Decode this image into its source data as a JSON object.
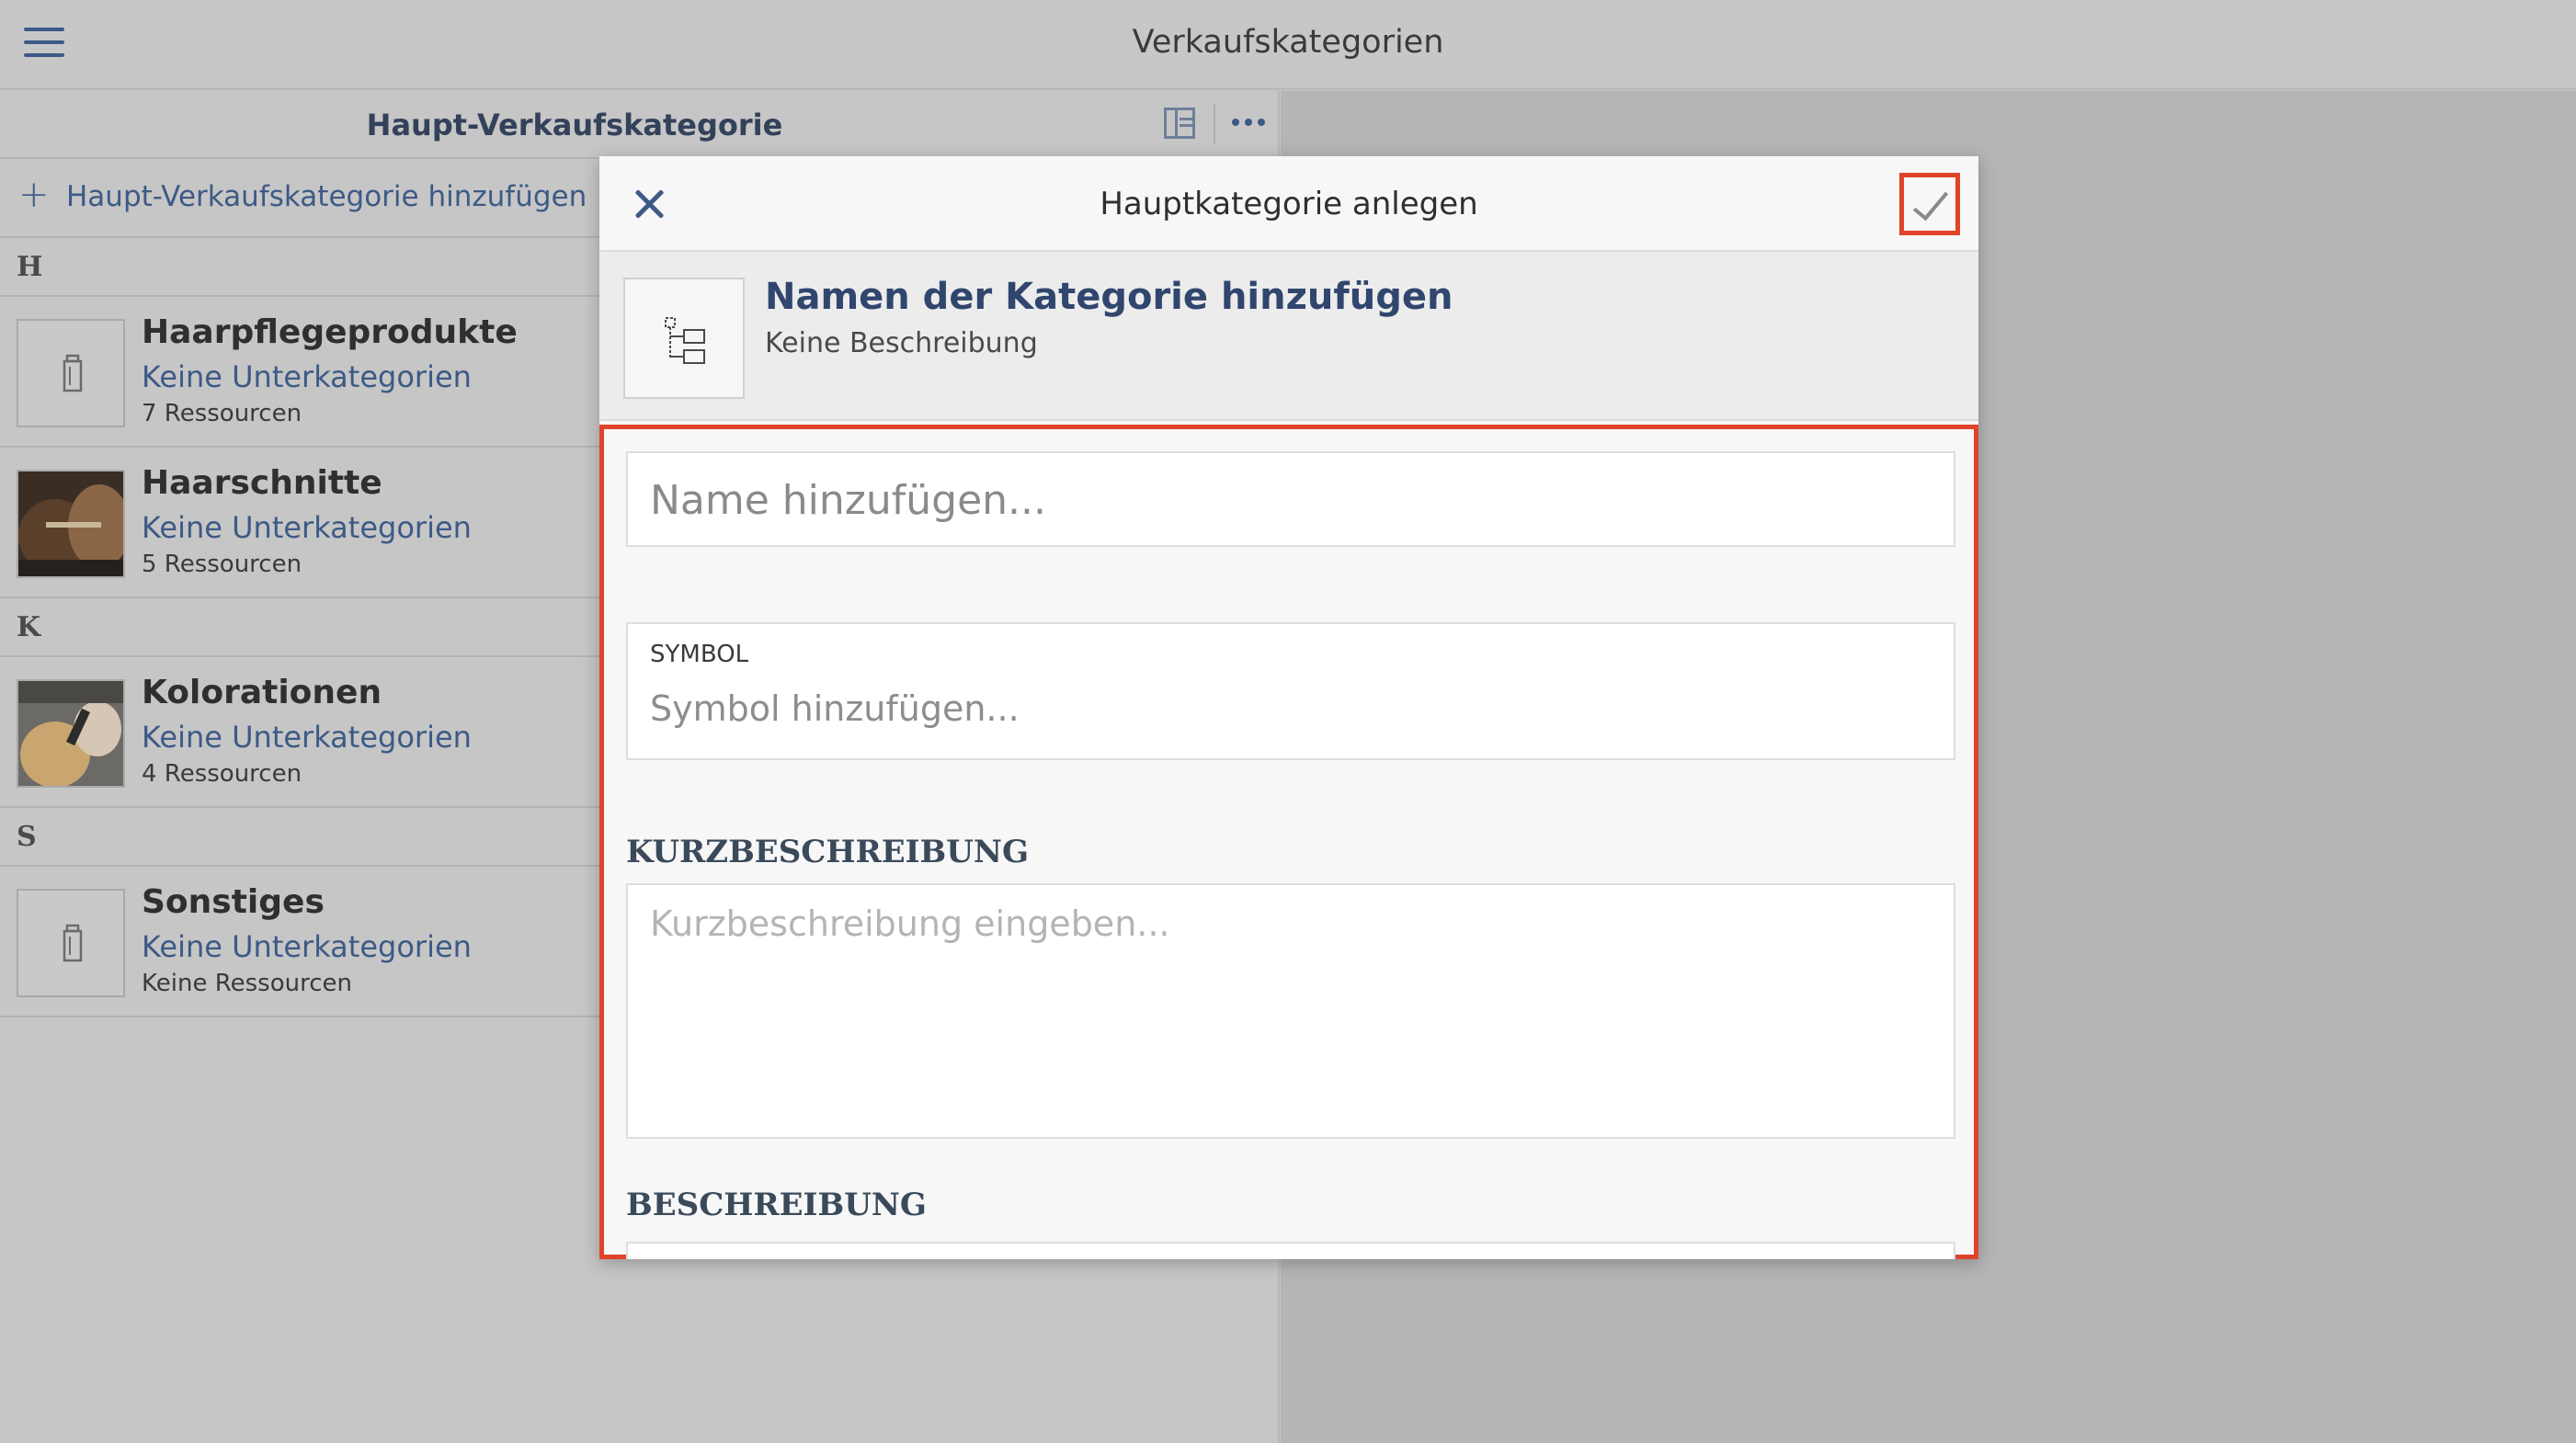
{
  "app": {
    "title": "Verkaufskategorien"
  },
  "list": {
    "header_title": "Haupt-Verkaufskategorie",
    "add_label": "Haupt-Verkaufskategorie hinzufügen",
    "sections": [
      {
        "letter": "H",
        "items": [
          {
            "title": "Haarpflegeprodukte",
            "subtitle": "Keine Unterkategorien",
            "resources": "7 Ressourcen",
            "thumb": "product-icon"
          },
          {
            "title": "Haarschnitte",
            "subtitle": "Keine Unterkategorien",
            "resources": "5 Ressourcen",
            "thumb": "photo"
          }
        ]
      },
      {
        "letter": "K",
        "items": [
          {
            "title": "Kolorationen",
            "subtitle": "Keine Unterkategorien",
            "resources": "4 Ressourcen",
            "thumb": "photo"
          }
        ]
      },
      {
        "letter": "S",
        "items": [
          {
            "title": "Sonstiges",
            "subtitle": "Keine Unterkategorien",
            "resources": "Keine Ressourcen",
            "thumb": "product-icon"
          }
        ]
      }
    ]
  },
  "modal": {
    "title": "Hauptkategorie anlegen",
    "summary_title": "Namen der Kategorie hinzufügen",
    "summary_desc": "Keine Beschreibung",
    "name_placeholder": "Name hinzufügen...",
    "symbol_label": "SYMBOL",
    "symbol_placeholder": "Symbol hinzufügen...",
    "kurz_label": "KURZBESCHREIBUNG",
    "kurz_placeholder": "Kurzbeschreibung eingeben...",
    "desc_label": "BESCHREIBUNG"
  },
  "colors": {
    "accent": "#3d5a86",
    "highlight": "#e0432b"
  }
}
